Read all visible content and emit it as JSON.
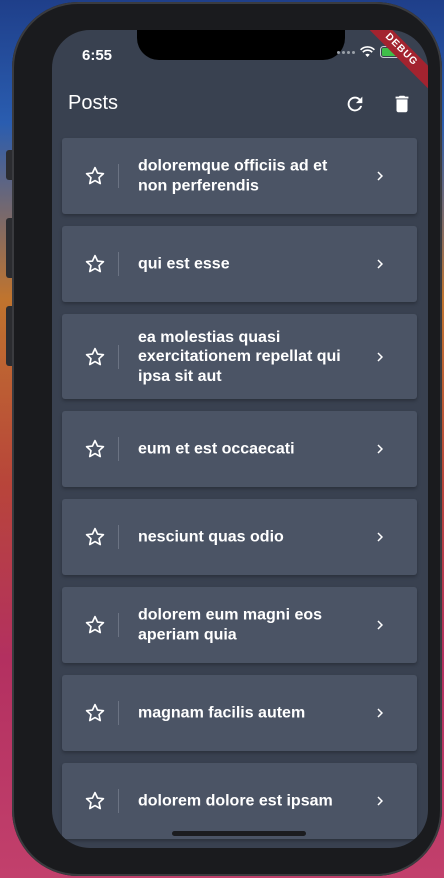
{
  "status_bar": {
    "time": "6:55"
  },
  "debug_banner": "DEBUG",
  "app_bar": {
    "title": "Posts",
    "refresh_icon": "refresh-icon",
    "delete_icon": "trash-icon"
  },
  "posts": [
    {
      "title": "doloremque officiis ad et non perferendis"
    },
    {
      "title": "qui est esse"
    },
    {
      "title": "ea molestias quasi exercitationem repellat qui ipsa sit aut"
    },
    {
      "title": "eum et est occaecati"
    },
    {
      "title": "nesciunt quas odio"
    },
    {
      "title": "dolorem eum magni eos aperiam quia"
    },
    {
      "title": "magnam facilis autem"
    },
    {
      "title": "dolorem dolore est ipsam"
    }
  ],
  "colors": {
    "screen_bg": "#394150",
    "card_bg": "#4b5465",
    "text": "#ffffff",
    "debug_banner": "#a3232f"
  }
}
